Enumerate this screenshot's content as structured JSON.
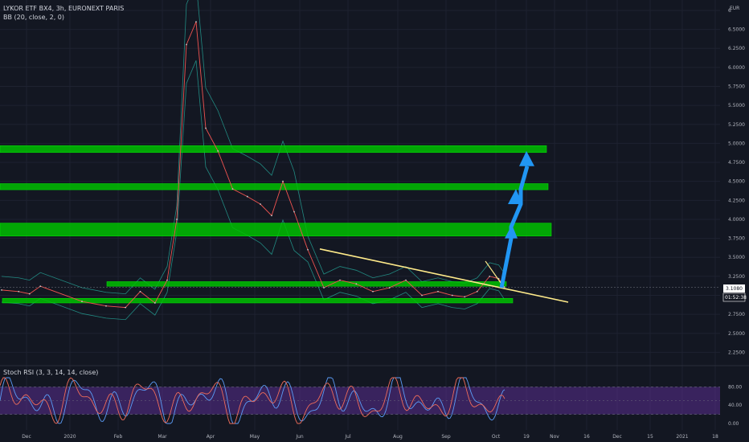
{
  "header": {
    "symbol_line": "LYKOR ETF BX4, 3h, EURONEXT PARIS",
    "indicator_bb": "BB (20, close, 2, 0)",
    "indicator_rsi": "Stoch RSI (3, 3, 14, 14, close)",
    "currency": "EUR"
  },
  "price_tags": {
    "last": "3.1080",
    "countdown": "01:52:38"
  },
  "chart_data": {
    "type": "line",
    "title": "LYKOR ETF BX4, 3h, EURONEXT PARIS",
    "price_axis": {
      "ticks": [
        2.25,
        2.5,
        2.75,
        3.0,
        3.25,
        3.5,
        3.75,
        4.0,
        4.25,
        4.5,
        4.75,
        5.0,
        5.25,
        5.5,
        5.75,
        6.0,
        6.25,
        6.5,
        6.75
      ],
      "tick_labels": [
        "2.2500",
        "2.5000",
        "2.7500",
        "3.0000",
        "3.2500",
        "3.5000",
        "3.7500",
        "4.0000",
        "4.2500",
        "4.5000",
        "4.7500",
        "5.0000",
        "5.2500",
        "5.5000",
        "5.7500",
        "6.0000",
        "6.2500",
        "6.5000",
        "6"
      ],
      "ylim": [
        2.0,
        6.9
      ]
    },
    "time_axis": {
      "labels": [
        "Dec",
        "2020",
        "Feb",
        "Mar",
        "Apr",
        "May",
        "Jun",
        "Jul",
        "Aug",
        "Sep",
        "Oct",
        "19",
        "Nov",
        "16",
        "Dec",
        "15",
        "2021",
        "18"
      ]
    },
    "price_series": [
      {
        "t": "Dec",
        "v": 3.07
      },
      {
        "t": "Dec",
        "v": 3.05
      },
      {
        "t": "Dec",
        "v": 3.02
      },
      {
        "t": "Dec",
        "v": 3.12
      },
      {
        "t": "2020",
        "v": 2.92
      },
      {
        "t": "2020",
        "v": 2.86
      },
      {
        "t": "Feb",
        "v": 2.84
      },
      {
        "t": "Feb",
        "v": 3.05
      },
      {
        "t": "Feb",
        "v": 2.9
      },
      {
        "t": "Mar",
        "v": 3.2
      },
      {
        "t": "Mar",
        "v": 4.0
      },
      {
        "t": "Mar",
        "v": 6.3
      },
      {
        "t": "Mar",
        "v": 6.6
      },
      {
        "t": "Mar",
        "v": 5.2
      },
      {
        "t": "Apr",
        "v": 4.9
      },
      {
        "t": "Apr",
        "v": 4.4
      },
      {
        "t": "Apr",
        "v": 4.3
      },
      {
        "t": "May",
        "v": 4.2
      },
      {
        "t": "May",
        "v": 4.05
      },
      {
        "t": "May",
        "v": 4.5
      },
      {
        "t": "May",
        "v": 4.1
      },
      {
        "t": "Jun",
        "v": 3.6
      },
      {
        "t": "Jun",
        "v": 3.1
      },
      {
        "t": "Jun",
        "v": 3.2
      },
      {
        "t": "Jul",
        "v": 3.15
      },
      {
        "t": "Jul",
        "v": 3.05
      },
      {
        "t": "Jul",
        "v": 3.1
      },
      {
        "t": "Aug",
        "v": 3.2
      },
      {
        "t": "Aug",
        "v": 3.0
      },
      {
        "t": "Aug",
        "v": 3.05
      },
      {
        "t": "Sep",
        "v": 3.0
      },
      {
        "t": "Sep",
        "v": 2.98
      },
      {
        "t": "Sep",
        "v": 3.05
      },
      {
        "t": "Sep",
        "v": 3.25
      },
      {
        "t": "Oct",
        "v": 3.22
      },
      {
        "t": "Oct",
        "v": 3.11
      }
    ],
    "zones": [
      {
        "name": "zone-1",
        "low": 4.88,
        "high": 4.97
      },
      {
        "name": "zone-2",
        "low": 4.39,
        "high": 4.47
      },
      {
        "name": "zone-3",
        "low": 3.78,
        "high": 3.95
      },
      {
        "name": "zone-4",
        "low": 3.12,
        "high": 3.18
      },
      {
        "name": "zone-5",
        "low": 2.9,
        "high": 2.96
      }
    ],
    "trendline": {
      "start": {
        "t": "Jun",
        "v": 3.61
      },
      "end": {
        "t": "Nov",
        "v": 2.91
      }
    },
    "target_arrow": {
      "from": 3.1,
      "to": 4.9
    },
    "rsi_axis": {
      "ticks": [
        0,
        40,
        80
      ],
      "tick_labels": [
        "0.00",
        "40.00",
        "80.00"
      ],
      "band": [
        20,
        80
      ]
    },
    "current_price": 3.108
  },
  "colors": {
    "background": "#131722",
    "zone_fill": "#00c000",
    "trendline": "#ffeb8a",
    "arrow": "#2196f3",
    "price_line": "#ef5350",
    "band_line": "#26a69a",
    "rsi_k": "#5b9cf6",
    "rsi_d": "#ef6c5a",
    "rsi_band": "#5a2d8f"
  }
}
